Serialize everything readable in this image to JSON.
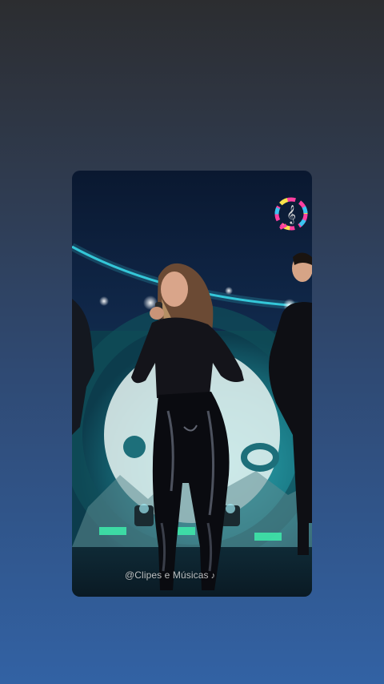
{
  "story": {
    "watermark_text": "@Clipes e Músicas",
    "watermark_icon": "music-note-icon"
  },
  "colors": {
    "page_top": "#2c2d30",
    "page_bottom": "#3262a4",
    "stage_glow": "#38d6e6",
    "screen_teal": "#1f8c96"
  }
}
